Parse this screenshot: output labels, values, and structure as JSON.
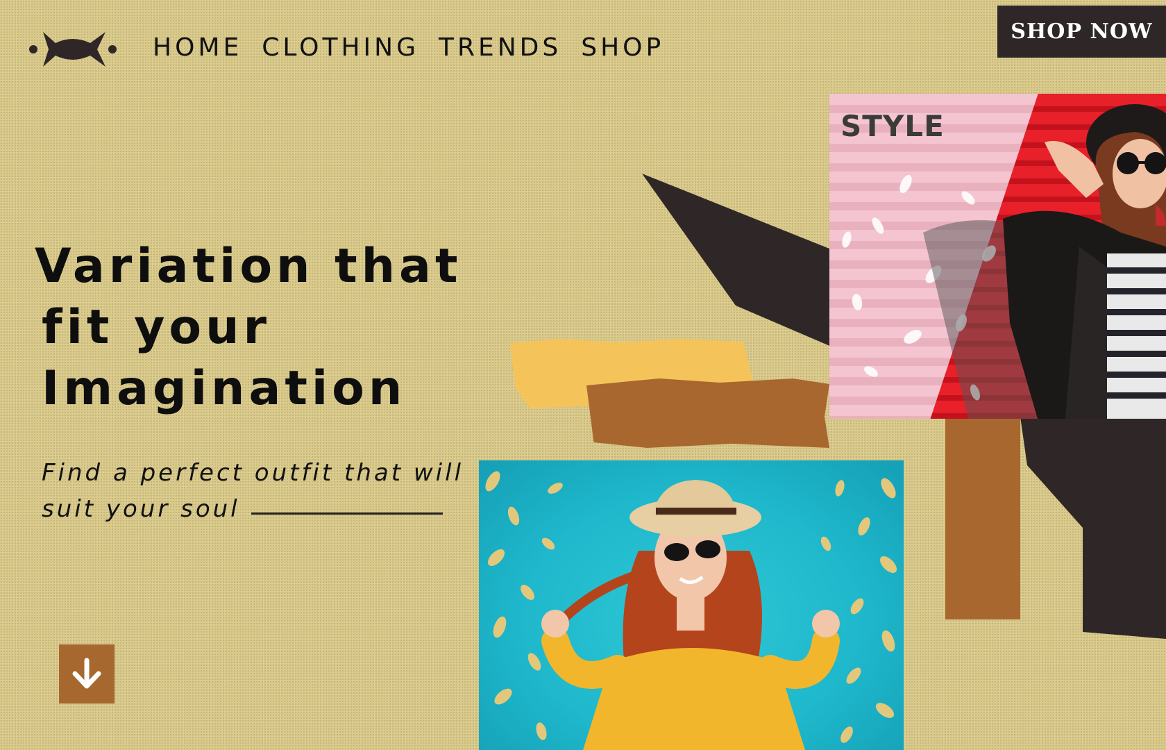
{
  "brand": {
    "logo_icon": "bow-logo-icon"
  },
  "nav": {
    "items": [
      "HOME",
      "CLOTHING",
      "TRENDS",
      "SHOP"
    ]
  },
  "cta": {
    "shop_now": "SHOP NOW"
  },
  "hero": {
    "headline_line1": "Variation that",
    "headline_line2": "fit your",
    "headline_line3": "Imagination",
    "tagline": "Find a perfect outfit that will suit your soul",
    "scroll_icon": "arrow-down-icon"
  },
  "gallery": {
    "style_label": "STYLE",
    "style_photo": "woman-sunglasses-leather-jacket-photo",
    "summer_photo": "woman-straw-hat-yellow-top-photo"
  },
  "colors": {
    "background": "#d9c98b",
    "dark": "#2f2727",
    "brown": "#a8672e",
    "yellow": "#f4c35a",
    "teal": "#1fb8cc",
    "red": "#e8202a",
    "pink": "#f2b8c6"
  }
}
